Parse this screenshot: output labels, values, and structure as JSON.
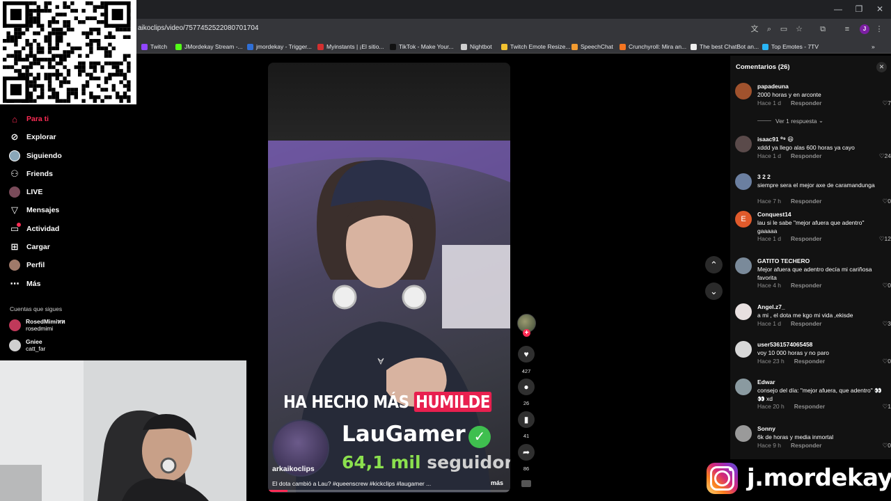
{
  "browser": {
    "url": "aikoclips/video/7577452522080701704",
    "profile_initial": "J",
    "bookmarks": [
      {
        "label": "Twitch",
        "color": "#9146ff"
      },
      {
        "label": "JMordekay Stream -...",
        "color": "#53fc18"
      },
      {
        "label": "jmordekay - Trigger...",
        "color": "#2f6fd6"
      },
      {
        "label": "Myinstants | ¡El sitio...",
        "color": "#d32f2f"
      },
      {
        "label": "TikTok - Make Your...",
        "color": "#111111"
      },
      {
        "label": "Nightbot",
        "color": "#cfcfcf"
      },
      {
        "label": "Twitch Emote Resize...",
        "color": "#f2c230"
      },
      {
        "label": "SpeechChat",
        "color": "#f29b30"
      },
      {
        "label": "Crunchyroll: Mira an...",
        "color": "#f47521"
      },
      {
        "label": "The best ChatBot an...",
        "color": "#eeeeee"
      },
      {
        "label": "Top Emotes - 7TV",
        "color": "#29b6f6"
      }
    ]
  },
  "nav": {
    "items": [
      {
        "label": "Para ti",
        "icon": "home-icon",
        "active": true
      },
      {
        "label": "Explorar",
        "icon": "compass-icon"
      },
      {
        "label": "Siguiendo",
        "icon": "following-avatar-icon"
      },
      {
        "label": "Friends",
        "icon": "friends-icon"
      },
      {
        "label": "LIVE",
        "icon": "live-icon"
      },
      {
        "label": "Mensajes",
        "icon": "send-icon"
      },
      {
        "label": "Actividad",
        "icon": "inbox-icon"
      },
      {
        "label": "Cargar",
        "icon": "upload-icon"
      },
      {
        "label": "Perfil",
        "icon": "profile-avatar-icon"
      },
      {
        "label": "Más",
        "icon": "more-icon"
      }
    ],
    "following_heading": "Cuentas que sigues",
    "following": [
      {
        "display": "RosedMimiหห",
        "user": "rosedmimi"
      },
      {
        "display": "Gniee",
        "user": "catt_far"
      }
    ]
  },
  "video": {
    "caption_overlay": "HA HECHO MÁS",
    "caption_highlight": "HUMILDE",
    "streamer": "LauGamer",
    "followers_count": "64,1 mil",
    "followers_label": "seguidores",
    "author": "arkaikoclips",
    "description": "El dota cambió a Lau? #queenscrew #kickclips #laugamer ...",
    "more": "más",
    "progress": 0.08,
    "likes": "427",
    "comments": "26",
    "saves": "41",
    "shares": "86"
  },
  "comments": {
    "title": "Comentarios (26)",
    "reply_label": "Responder",
    "view_replies": "Ver 1 respuesta",
    "list": [
      {
        "user": "papadeuna",
        "text": "2000 horas y en arconte",
        "time": "Hace 1 d",
        "likes": "7",
        "avatar": "#a0522d"
      },
      {
        "user": "isaac91 ⁰⁹ 😆",
        "text": "xddd ya llego alas 600 horas ya cayo",
        "time": "Hace 1 d",
        "likes": "24",
        "avatar": "#5a4a4a"
      },
      {
        "user": "3 2 2",
        "text": "siempre sera el mejor axe de caramandunga",
        "time": "Hace 7 h",
        "likes": "0",
        "avatar": "#6b7fa0"
      },
      {
        "user": "Conquest14",
        "text": "lau si le sabe \"mejor afuera que adentro\" gaaaaa",
        "time": "Hace 1 d",
        "likes": "12",
        "avatar": "#e05a2b",
        "initial": "E"
      },
      {
        "user": "GATITO TECHERO",
        "text": "Mejor afuera que adentro decía mi cariñosa favorita",
        "time": "Hace 4 h",
        "likes": "0",
        "avatar": "#7a8a9a"
      },
      {
        "user": "Angel.z7_",
        "text": "a mi , el dota me kgo mi vida ,ekisde",
        "time": "Hace 1 d",
        "likes": "3",
        "avatar": "#e8e0e0"
      },
      {
        "user": "user5361574065458",
        "text": "voy 10 000 horas y no paro",
        "time": "Hace 23 h",
        "likes": "0",
        "avatar": "#d8d8d8"
      },
      {
        "user": "Edwar",
        "text": "consejo del día: \"mejor afuera, que adentro\" 👀👀 xd",
        "time": "Hace 20 h",
        "likes": "1",
        "avatar": "#8a9aa0"
      },
      {
        "user": "Sonny",
        "text": "6k de horas y media inmortal",
        "time": "Hace 9 h",
        "likes": "0",
        "avatar": "#9a9a9a"
      }
    ]
  },
  "overlay": {
    "instagram_handle": "j.mordekay"
  }
}
